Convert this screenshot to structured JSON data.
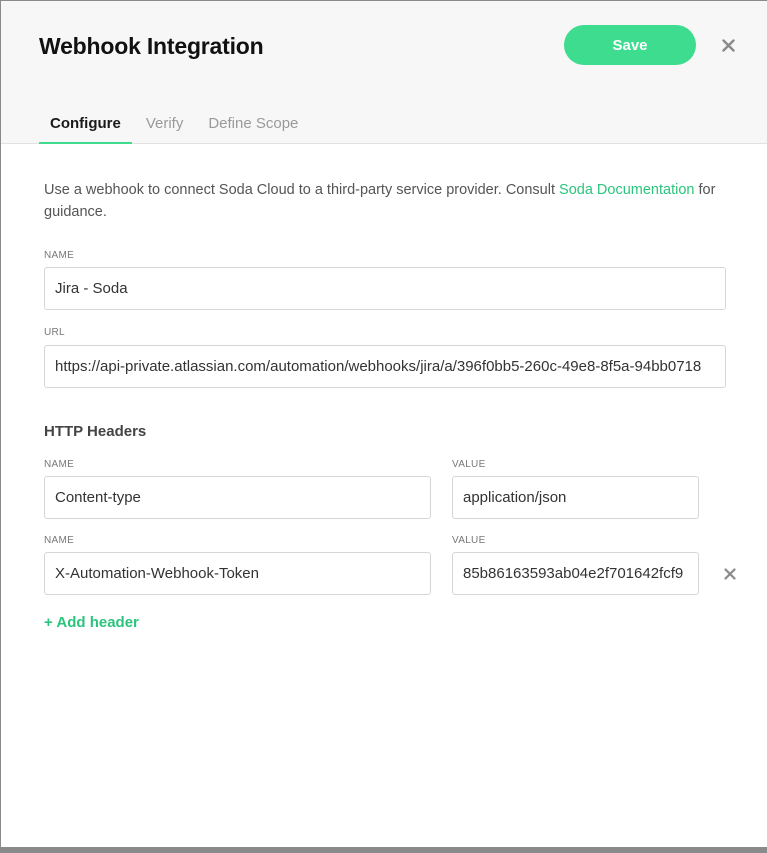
{
  "modal": {
    "title": "Webhook Integration",
    "save_label": "Save",
    "close_icon": "close-icon"
  },
  "tabs": [
    {
      "label": "Configure",
      "active": true
    },
    {
      "label": "Verify",
      "active": false
    },
    {
      "label": "Define Scope",
      "active": false
    }
  ],
  "description": {
    "text_before": "Use a webhook to connect Soda Cloud to a third-party service provider. Consult ",
    "link_text": "Soda Documentation",
    "text_after": " for guidance."
  },
  "form": {
    "name_label": "NAME",
    "name_value": "Jira - Soda",
    "url_label": "URL",
    "url_value": "https://api-private.atlassian.com/automation/webhooks/jira/a/396f0bb5-260c-49e8-8f5a-94bb0718"
  },
  "http_headers": {
    "title": "HTTP Headers",
    "rows": [
      {
        "name_label": "NAME",
        "name_value": "Content-type",
        "value_label": "VALUE",
        "value_value": "application/json"
      },
      {
        "name_label": "NAME",
        "name_value": "X-Automation-Webhook-Token",
        "value_label": "VALUE",
        "value_value": "85b86163593ab04e2f701642fcf9"
      }
    ],
    "add_label": "+ Add header"
  },
  "colors": {
    "accent": "#3ddc8f",
    "link": "#2cc47d"
  }
}
